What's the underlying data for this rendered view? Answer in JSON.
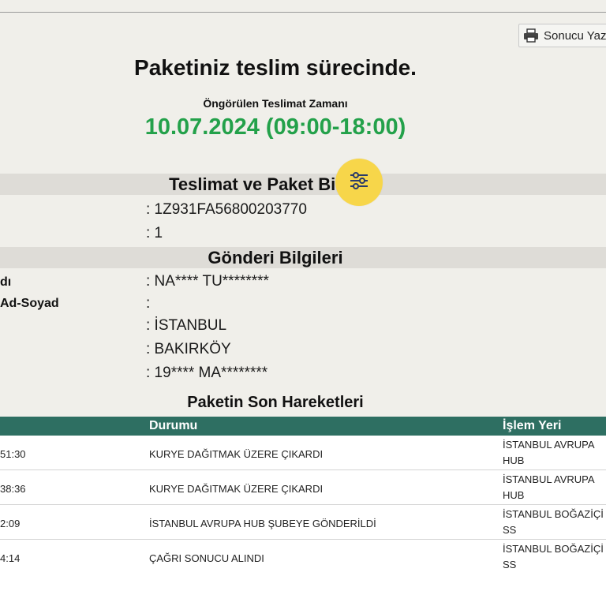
{
  "toolbar": {
    "print_label": "Sonucu Yazdır"
  },
  "header": {
    "title": "Paketiniz teslim sürecinde.",
    "eta_label": "Öngörülen Teslimat Zamanı",
    "eta_value": "10.07.2024 (09:00-18:00)"
  },
  "sections": {
    "delivery_title": "Teslimat ve Paket Bilgileri",
    "shipment_title": "Gönderi Bilgileri",
    "moves_title": "Paketin Son Hareketleri"
  },
  "delivery": {
    "tracking_value": ": 1Z931FA56800203770",
    "count_value": ": 1"
  },
  "shipment": {
    "label1": "dı",
    "value1": ": NA**** TU********",
    "label2": "Ad-Soyad",
    "value2": ":",
    "value3": ": İSTANBUL",
    "value4": ": BAKIRKÖY",
    "value5": ": 19**** MA********"
  },
  "table": {
    "headers": [
      "",
      "Durumu",
      "İşlem Yeri"
    ],
    "rows": [
      {
        "time": "51:30",
        "status": "KURYE DAĞITMAK ÜZERE ÇIKARDI",
        "place1": "İSTANBUL AVRUPA",
        "place2": "HUB"
      },
      {
        "time": "38:36",
        "status": "KURYE DAĞITMAK ÜZERE ÇIKARDI",
        "place1": "İSTANBUL AVRUPA",
        "place2": "HUB"
      },
      {
        "time": "2:09",
        "status": "İSTANBUL AVRUPA HUB ŞUBEYE GÖNDERİLDİ",
        "place1": "İSTANBUL BOĞAZİÇİ",
        "place2": "SS"
      },
      {
        "time": "4:14",
        "status": "ÇAĞRI SONUCU ALINDI",
        "place1": "İSTANBUL BOĞAZİÇİ",
        "place2": "SS"
      }
    ]
  },
  "colors": {
    "accent_green": "#23a14a",
    "table_header": "#2e6f62",
    "fab": "#f7d64a"
  },
  "icons": {
    "print": "printer-icon",
    "fab": "sliders-icon"
  }
}
